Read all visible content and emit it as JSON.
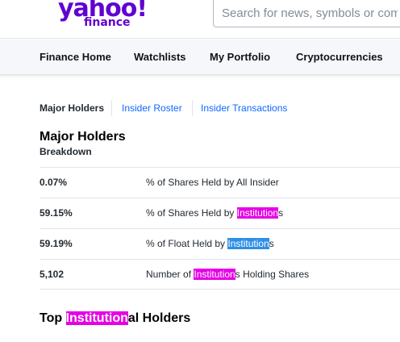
{
  "header": {
    "logo_primary": "yahoo!",
    "logo_secondary": "finance",
    "search_placeholder": "Search for news, symbols or companies"
  },
  "nav": {
    "items": [
      {
        "label": "Finance Home"
      },
      {
        "label": "Watchlists"
      },
      {
        "label": "My Portfolio"
      },
      {
        "label": "Cryptocurrencies"
      }
    ]
  },
  "subtabs": [
    {
      "label": "Major Holders",
      "active": true
    },
    {
      "label": "Insider Roster",
      "active": false
    },
    {
      "label": "Insider Transactions",
      "active": false
    }
  ],
  "major_holders": {
    "title": "Major Holders",
    "subtitle": "Breakdown",
    "rows": [
      {
        "value": "0.07%",
        "label_pre": "% of Shares Held by All Insider",
        "label_hl": "",
        "label_post": ""
      },
      {
        "value": "59.15%",
        "label_pre": "% of Shares Held by ",
        "label_hl": "Institution",
        "label_post": "s"
      },
      {
        "value": "59.19%",
        "label_pre": "% of Float Held by ",
        "label_hl": "Institution",
        "label_post": "s"
      },
      {
        "value": "5,102",
        "label_pre": "Number of ",
        "label_hl": "Institution",
        "label_post": "s Holding Shares"
      }
    ]
  },
  "top_holders": {
    "title_pre": "Top ",
    "title_hl": "Institution",
    "title_post": "al Holders"
  },
  "colors": {
    "brand": "#6001d2",
    "link": "#0f69ff",
    "highlight_primary": "#e600e6",
    "highlight_active": "#2f8fe6"
  }
}
